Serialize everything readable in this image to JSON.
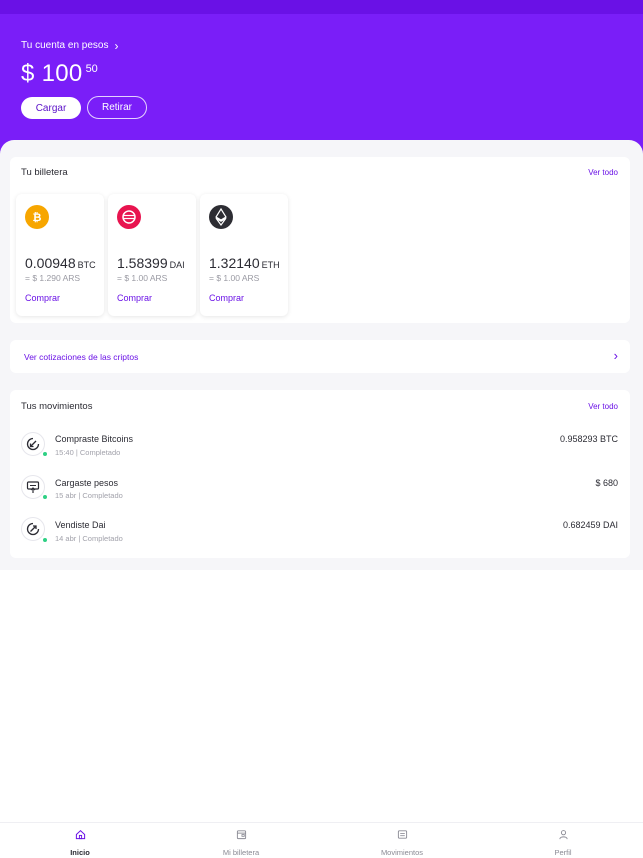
{
  "header": {
    "account_label": "Tu cuenta en pesos",
    "balance_main": "$ 100",
    "balance_cents": "50",
    "cargar_label": "Cargar",
    "retirar_label": "Retirar"
  },
  "wallet": {
    "title": "Tu billetera",
    "ver_todo": "Ver todo",
    "items": [
      {
        "icon": "bitcoin-icon",
        "color": "#f7a600",
        "amount": "0.00948",
        "symbol": "BTC",
        "ars": "= $ 1.290 ARS",
        "action": "Comprar"
      },
      {
        "icon": "dai-icon",
        "color": "#e8144f",
        "amount": "1.58399",
        "symbol": "DAI",
        "ars": "= $ 1.00 ARS",
        "action": "Comprar"
      },
      {
        "icon": "ethereum-icon",
        "color": "#2d2d33",
        "amount": "1.32140",
        "symbol": "ETH",
        "ars": "= $ 1.00 ARS",
        "action": "Comprar"
      }
    ]
  },
  "cotizaciones": {
    "label": "Ver cotizaciones de las criptos"
  },
  "movimientos": {
    "title": "Tus movimientos",
    "ver_todo": "Ver todo",
    "items": [
      {
        "icon": "buy-icon",
        "title": "Compraste Bitcoins",
        "sub": "15:40 | Completado",
        "amount": "0.958293 BTC"
      },
      {
        "icon": "deposit-icon",
        "title": "Cargaste pesos",
        "sub": "15 abr | Completado",
        "amount": "$ 680"
      },
      {
        "icon": "sell-icon",
        "title": "Vendiste Dai",
        "sub": "14 abr | Completado",
        "amount": "0.682459 DAI"
      }
    ]
  },
  "nav": {
    "items": [
      {
        "label": "Inicio",
        "icon": "home-icon"
      },
      {
        "label": "Mi billetera",
        "icon": "wallet-icon"
      },
      {
        "label": "Movimientos",
        "icon": "list-icon"
      },
      {
        "label": "Perfil",
        "icon": "user-icon"
      }
    ]
  },
  "colors": {
    "brand": "#7a1ef8",
    "accent": "#6a11e6",
    "status_ok": "#2ed084"
  }
}
